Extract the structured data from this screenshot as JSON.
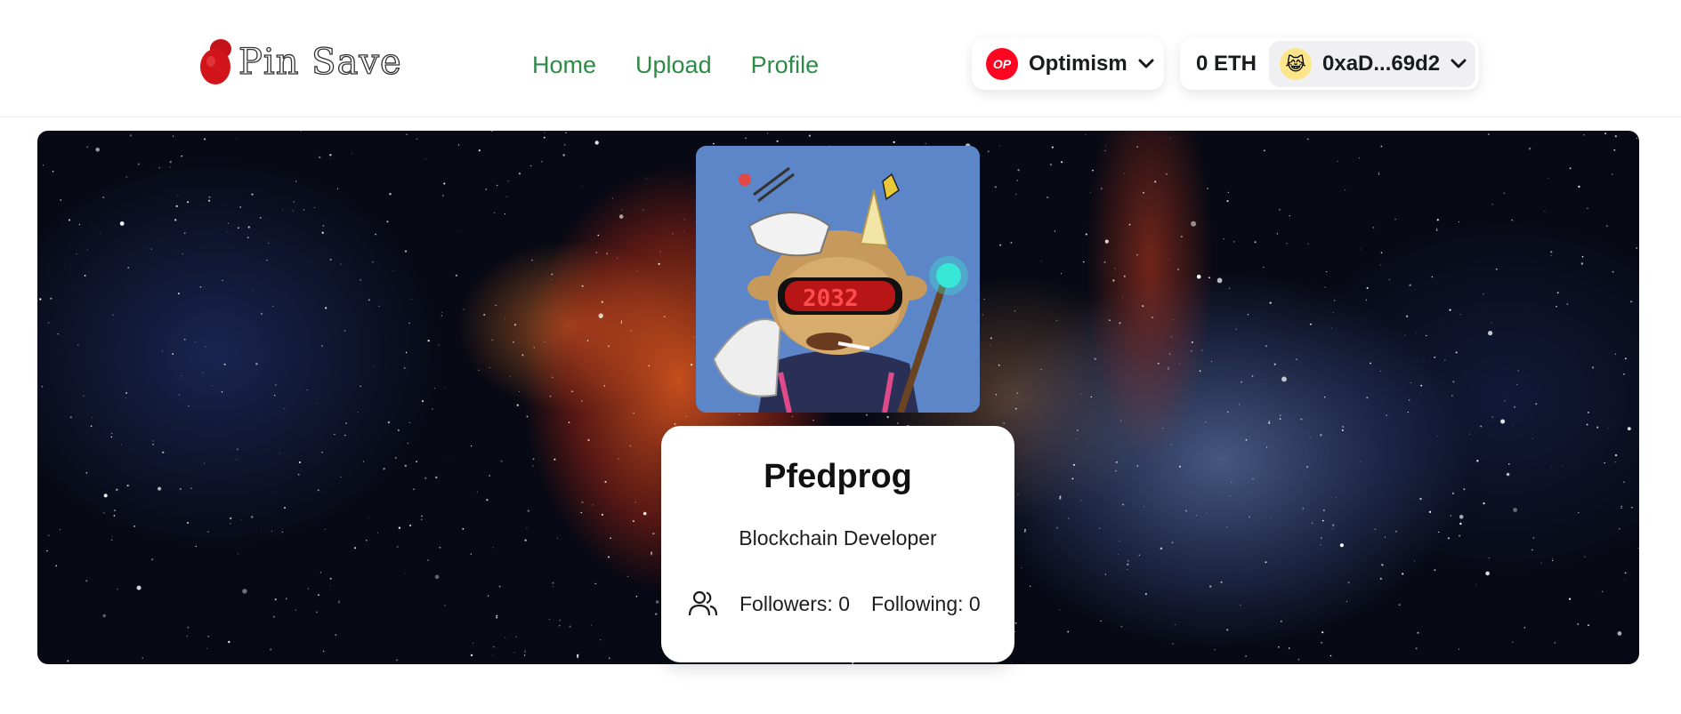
{
  "header": {
    "logo_text": "Pin Save",
    "nav": [
      {
        "label": "Home"
      },
      {
        "label": "Upload"
      },
      {
        "label": "Profile"
      }
    ],
    "chain": {
      "icon_label": "OP",
      "name": "Optimism"
    },
    "account": {
      "balance": "0 ETH",
      "address": "0xaD...69d2"
    }
  },
  "profile": {
    "name": "Pfedprog",
    "bio": "Blockchain Developer",
    "followers_label": "Followers: 0",
    "following_label": "Following: 0"
  },
  "colors": {
    "nav_link": "#2e8a47",
    "optimism_red": "#ff0420",
    "logo_pin": "#d1151b"
  },
  "icons": [
    "pin-logo-icon",
    "optimism-icon",
    "chevron-down-icon",
    "account-avatar-icon",
    "users-icon"
  ]
}
